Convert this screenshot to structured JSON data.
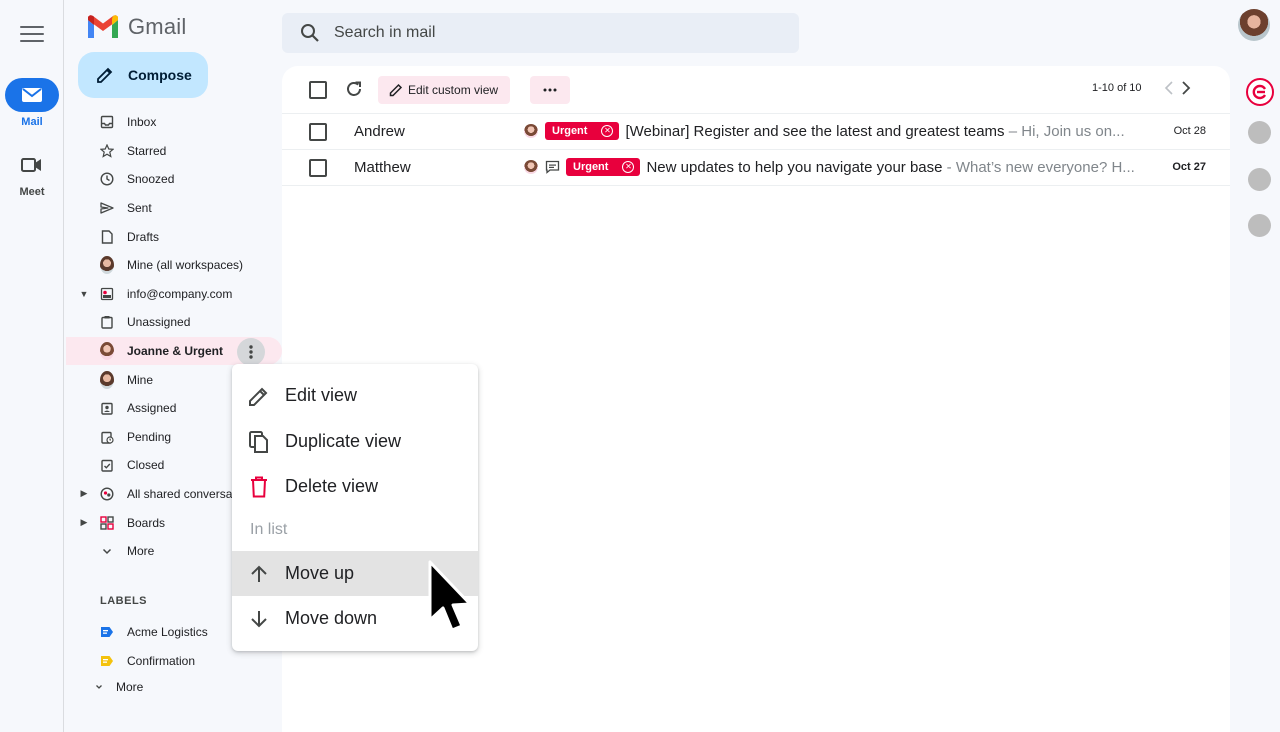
{
  "app": {
    "name": "Gmail"
  },
  "rail": {
    "mail_label": "Mail",
    "meet_label": "Meet",
    "mail_color": "#1a73e8"
  },
  "compose": {
    "label": "Compose",
    "bg_color": "#c2e7ff"
  },
  "search": {
    "placeholder": "Search in mail"
  },
  "nav": {
    "items": [
      {
        "label": "Inbox",
        "icon": "inbox-icon"
      },
      {
        "label": "Starred",
        "icon": "star-icon"
      },
      {
        "label": "Snoozed",
        "icon": "clock-icon"
      },
      {
        "label": "Sent",
        "icon": "send-icon"
      },
      {
        "label": "Drafts",
        "icon": "draft-icon"
      },
      {
        "label": "Mine (all workspaces)",
        "icon": "avatar"
      },
      {
        "label": "info@company.com",
        "icon": "shared-inbox-icon"
      },
      {
        "label": "Unassigned",
        "icon": "clipboard-icon"
      },
      {
        "label": "Joanne & Urgent",
        "icon": "avatar",
        "active": true
      },
      {
        "label": "Mine",
        "icon": "avatar"
      },
      {
        "label": "Assigned",
        "icon": "assigned-icon"
      },
      {
        "label": "Pending",
        "icon": "pending-icon"
      },
      {
        "label": "Closed",
        "icon": "closed-icon"
      },
      {
        "label": "All shared conversations",
        "icon": "shared-conversations-icon"
      },
      {
        "label": "Boards",
        "icon": "boards-icon"
      },
      {
        "label": "More",
        "icon": "chevron-down-icon"
      }
    ]
  },
  "labels": {
    "header": "LABELS",
    "items": [
      {
        "label": "Acme Logistics",
        "color": "#1a73e8"
      },
      {
        "label": "Confirmation",
        "color": "#f4c20d"
      }
    ],
    "more": "More"
  },
  "toolbar": {
    "edit_view_label": "Edit custom view",
    "more_label": "···",
    "pager": "1-10 of 10"
  },
  "emails": [
    {
      "sender": "Andrew",
      "tag": "Urgent",
      "subject": "[Webinar] Register and see the latest and greatest teams",
      "snippet": " – Hi, Join us on...",
      "date": "Oct 28",
      "has_comment": false
    },
    {
      "sender": "Matthew",
      "tag": "Urgent",
      "subject": "New updates to help you navigate your base",
      "snippet": " - What’s new everyone? H...",
      "date": "Oct 27",
      "has_comment": true
    }
  ],
  "context_menu": {
    "edit_view": "Edit view",
    "duplicate_view": "Duplicate view",
    "delete_view": "Delete view",
    "section": "In list",
    "move_up": "Move up",
    "move_down": "Move down"
  },
  "colors": {
    "urgent": "#e8003d",
    "active_nav": "#fce8ef",
    "delete_icon": "#e8003d"
  }
}
